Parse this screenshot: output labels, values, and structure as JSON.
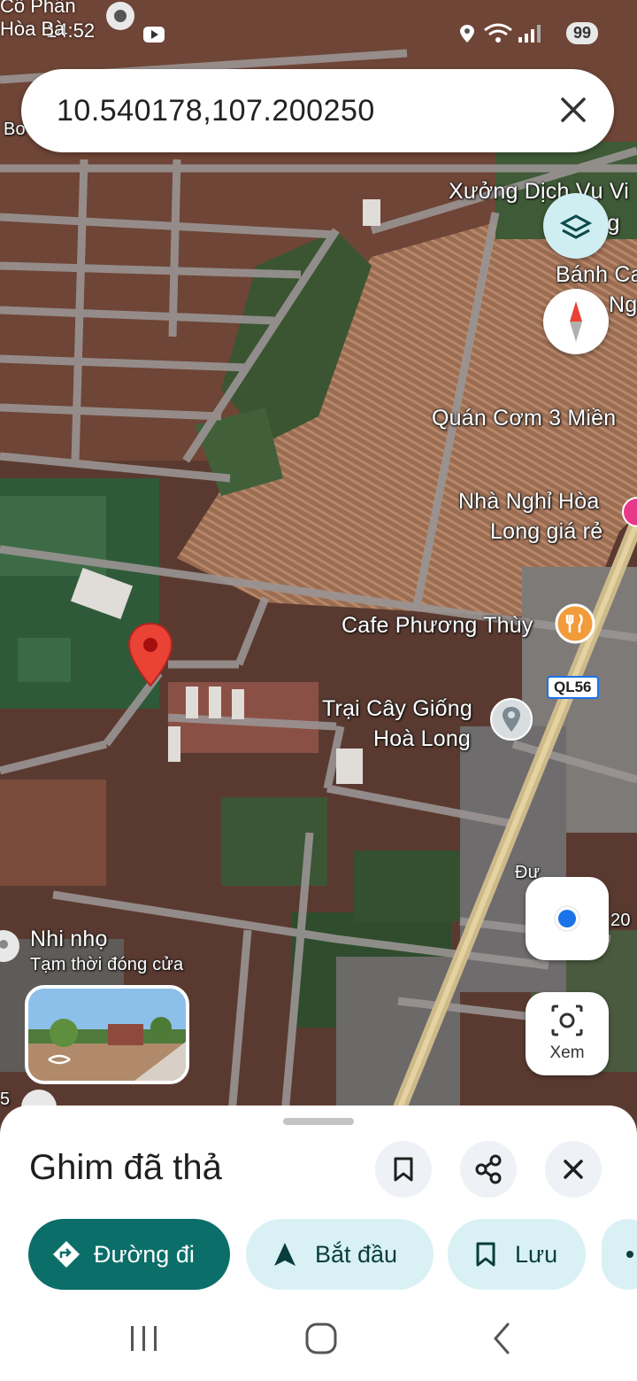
{
  "status_bar": {
    "time": "14:52",
    "top_left_partial": "Cổ Phần\nHòa Bà",
    "battery": "99"
  },
  "search": {
    "value": "10.540178,107.200250"
  },
  "map": {
    "labels": {
      "workshop": "Xưởng Dịch Vụ Vi",
      "workshop_2": "Cũng",
      "banh": "Bánh Ca",
      "banh_2": "Ng",
      "quan_com": "Quán Cơm 3 Miền",
      "nha_nghi_1": "Nhà Nghỉ Hòa",
      "nha_nghi_2": "Long giá rẻ",
      "cafe": "Cafe Phương Thùy",
      "trai_1": "Trại Cây Giống",
      "trai_2": "Hoà Long",
      "road_badge": "QL56",
      "nhi_nho": "Nhi nhọ",
      "nhi_nho_status": "Tạm thời đóng cửa",
      "top_left_bo": "Bo",
      "road_label_d": "Đư",
      "road_label_20": "20",
      "edge_5": "5"
    },
    "lens_label": "Xem"
  },
  "sheet": {
    "title": "Ghim đã thả",
    "actions": {
      "directions": "Đường đi",
      "start": "Bắt đầu",
      "save": "Lưu"
    }
  },
  "colors": {
    "primary": "#0b57d0",
    "directions_bg": "#0b6e69",
    "pill_bg": "#d9f1f5",
    "pin_red": "#ea4335"
  }
}
